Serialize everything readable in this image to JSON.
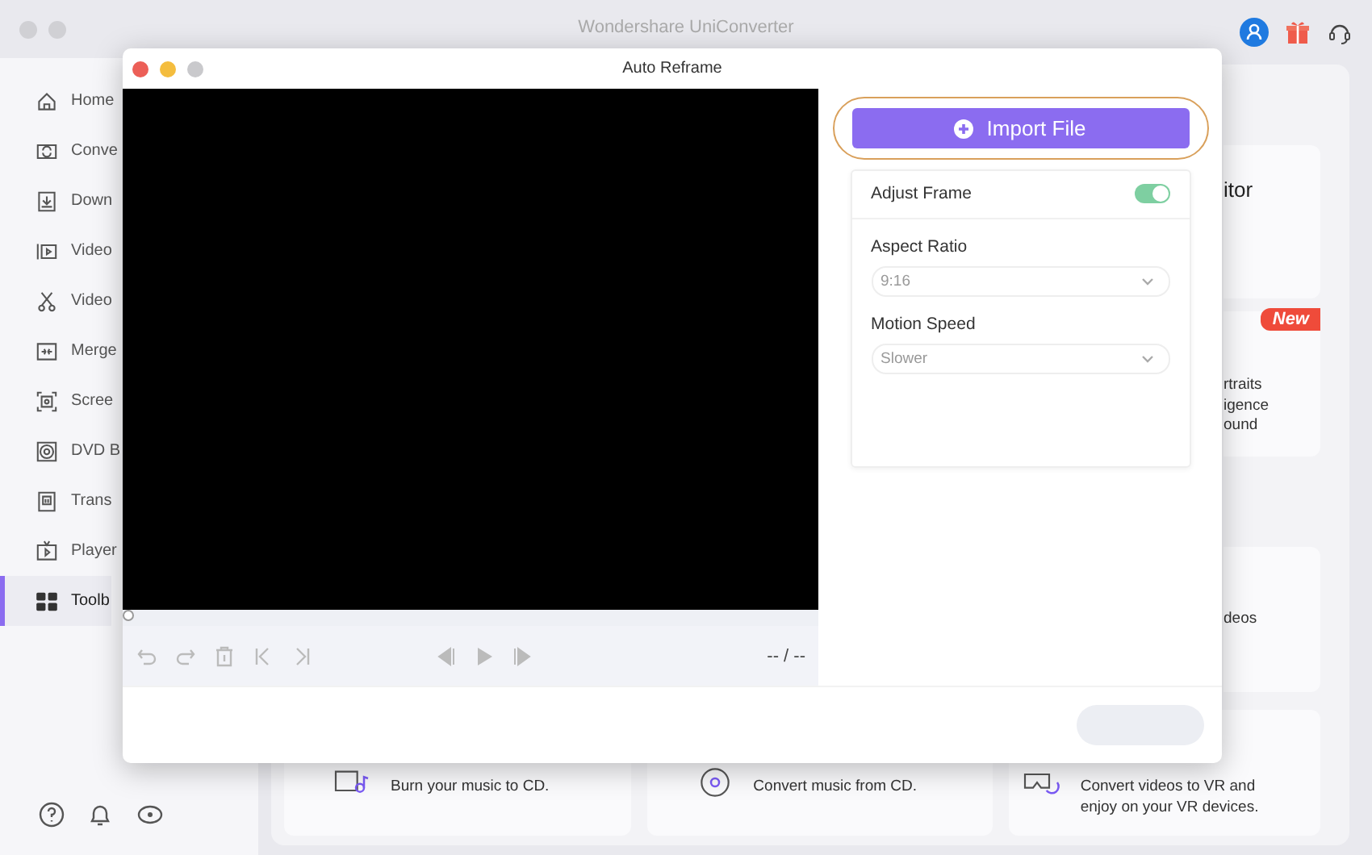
{
  "window": {
    "title": "Wondershare UniConverter"
  },
  "sidebar": {
    "items": [
      {
        "label": "Home",
        "selected": false
      },
      {
        "label": "Conve",
        "selected": false
      },
      {
        "label": "Down",
        "selected": false
      },
      {
        "label": "Video",
        "selected": false
      },
      {
        "label": "Video",
        "selected": false
      },
      {
        "label": "Merge",
        "selected": false
      },
      {
        "label": "Scree",
        "selected": false
      },
      {
        "label": "DVD B",
        "selected": false
      },
      {
        "label": "Trans",
        "selected": false
      },
      {
        "label": "Player",
        "selected": false
      },
      {
        "label": "Toolb",
        "selected": true
      }
    ]
  },
  "right_cards": [
    {
      "lines": [
        "itor"
      ],
      "kind": "title"
    },
    {
      "lines": [
        "rtraits",
        "igence",
        "ound"
      ],
      "badge": "New",
      "kind": "desc"
    },
    {
      "lines": [
        "deos"
      ],
      "kind": "desc"
    }
  ],
  "bottom_cards": [
    {
      "lines": [
        "Burn your music to CD."
      ]
    },
    {
      "lines": [
        "Convert music from CD."
      ]
    },
    {
      "lines": [
        "Convert videos to VR and",
        "enjoy on your VR devices."
      ]
    }
  ],
  "dialog": {
    "title": "Auto Reframe",
    "time": "-- / --",
    "import_button": "Import File",
    "settings": [
      {
        "kind": "toggle",
        "label": "Adjust Frame",
        "on": true
      },
      {
        "kind": "select",
        "label": "Aspect Ratio",
        "value": "9:16"
      },
      {
        "kind": "select",
        "label": "Motion Speed",
        "value": "Slower"
      }
    ],
    "export_disabled": true
  }
}
